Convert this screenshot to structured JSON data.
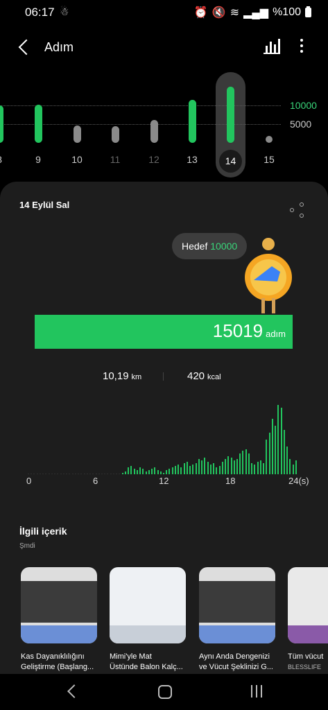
{
  "status_bar": {
    "time": "06:17",
    "battery": "%100"
  },
  "header": {
    "title": "Adım"
  },
  "day_strip": {
    "axis_labels": [
      "10000",
      "5000"
    ],
    "selected_day": "14",
    "days": [
      {
        "label": "8",
        "steps": 10000,
        "goal_met": true
      },
      {
        "label": "9",
        "steps": 10200,
        "goal_met": true
      },
      {
        "label": "10",
        "steps": 4700,
        "goal_met": false
      },
      {
        "label": "11",
        "steps": 4500,
        "goal_met": false
      },
      {
        "label": "12",
        "steps": 6200,
        "goal_met": false
      },
      {
        "label": "13",
        "steps": 11500,
        "goal_met": true
      },
      {
        "label": "14",
        "steps": 15019,
        "goal_met": true
      },
      {
        "label": "15",
        "steps": 0,
        "goal_met": false
      }
    ],
    "colors": {
      "goal": "#22c55e",
      "below": "#8a8a8a"
    }
  },
  "card": {
    "date": "14 Eylül Sal",
    "goal_label": "Hedef",
    "goal_value": "10000",
    "steps_value": "15019",
    "steps_unit": "adım",
    "distance_value": "10,19",
    "distance_unit": "km",
    "calories_value": "420",
    "calories_unit": "kcal"
  },
  "chart_data": {
    "type": "bar",
    "x_tick_labels": [
      "0",
      "6",
      "12",
      "18",
      "24(s)"
    ],
    "xlim": [
      0,
      24
    ],
    "values": [
      0,
      0,
      0,
      0,
      0,
      0,
      0,
      0,
      0,
      0,
      0,
      0,
      0,
      0,
      0,
      0,
      0,
      0,
      0,
      0,
      0,
      0,
      0,
      0,
      0,
      0,
      0,
      0,
      0,
      0,
      0,
      0,
      2,
      4,
      10,
      12,
      8,
      6,
      10,
      8,
      4,
      6,
      8,
      10,
      6,
      4,
      2,
      6,
      8,
      10,
      12,
      14,
      10,
      16,
      18,
      12,
      14,
      16,
      22,
      20,
      24,
      18,
      14,
      16,
      10,
      12,
      18,
      22,
      26,
      24,
      20,
      22,
      30,
      34,
      36,
      30,
      16,
      14,
      18,
      20,
      16,
      50,
      60,
      80,
      70,
      100,
      96,
      64,
      40,
      22,
      14,
      20
    ],
    "color": "#22c55e"
  },
  "related": {
    "title": "İlgili içerik",
    "subtitle": "Şmdi",
    "items": [
      {
        "caption_1": "Kas Dayanıklılığını",
        "caption_2": "Geliştirme (Başlang..."
      },
      {
        "caption_1": "Mimi'yle Mat",
        "caption_2": "Üstünde Balon Kalç..."
      },
      {
        "caption_1": "Aynı Anda Dengenizi",
        "caption_2": "ve Vücut Şeklinizi G..."
      },
      {
        "caption_1": "Tüm vücut",
        "caption_2": "BLESSLIFE"
      }
    ]
  }
}
